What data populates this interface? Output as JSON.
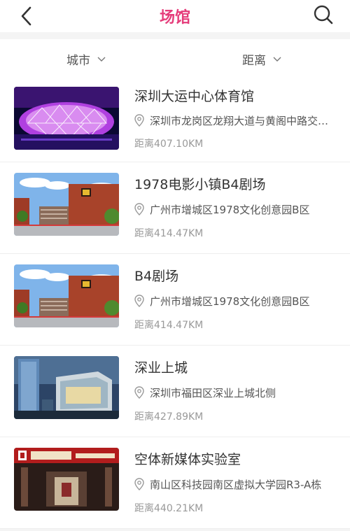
{
  "header": {
    "title": "场馆",
    "back_icon": "chevron-left-icon",
    "search_icon": "search-icon"
  },
  "filters": [
    {
      "label": "城市",
      "icon": "chevron-down-icon"
    },
    {
      "label": "距离",
      "icon": "chevron-down-icon"
    }
  ],
  "venues": [
    {
      "name": "深圳大运中心体育馆",
      "address": "深圳市龙岗区龙翔大道与黄阁中路交汇处",
      "distance": "距离407.10KM",
      "image": "stadium-night-photo"
    },
    {
      "name": "1978电影小镇B4剧场",
      "address": "广州市增城区1978文化创意园B区",
      "distance": "距离414.47KM",
      "image": "red-brick-building-photo"
    },
    {
      "name": "B4剧场",
      "address": "广州市增城区1978文化创意园B区",
      "distance": "距离414.47KM",
      "image": "red-brick-building-photo"
    },
    {
      "name": "深业上城",
      "address": "深圳市福田区深业上城北侧",
      "distance": "距离427.89KM",
      "image": "modern-glass-building-photo"
    },
    {
      "name": "空体新媒体实验室",
      "address": "南山区科技园南区虚拟大学园R3-A栋",
      "distance": "距离440.21KM",
      "image": "gallery-entrance-photo"
    }
  ],
  "colors": {
    "accent": "#e53c7a",
    "background": "#f4f4f4"
  }
}
